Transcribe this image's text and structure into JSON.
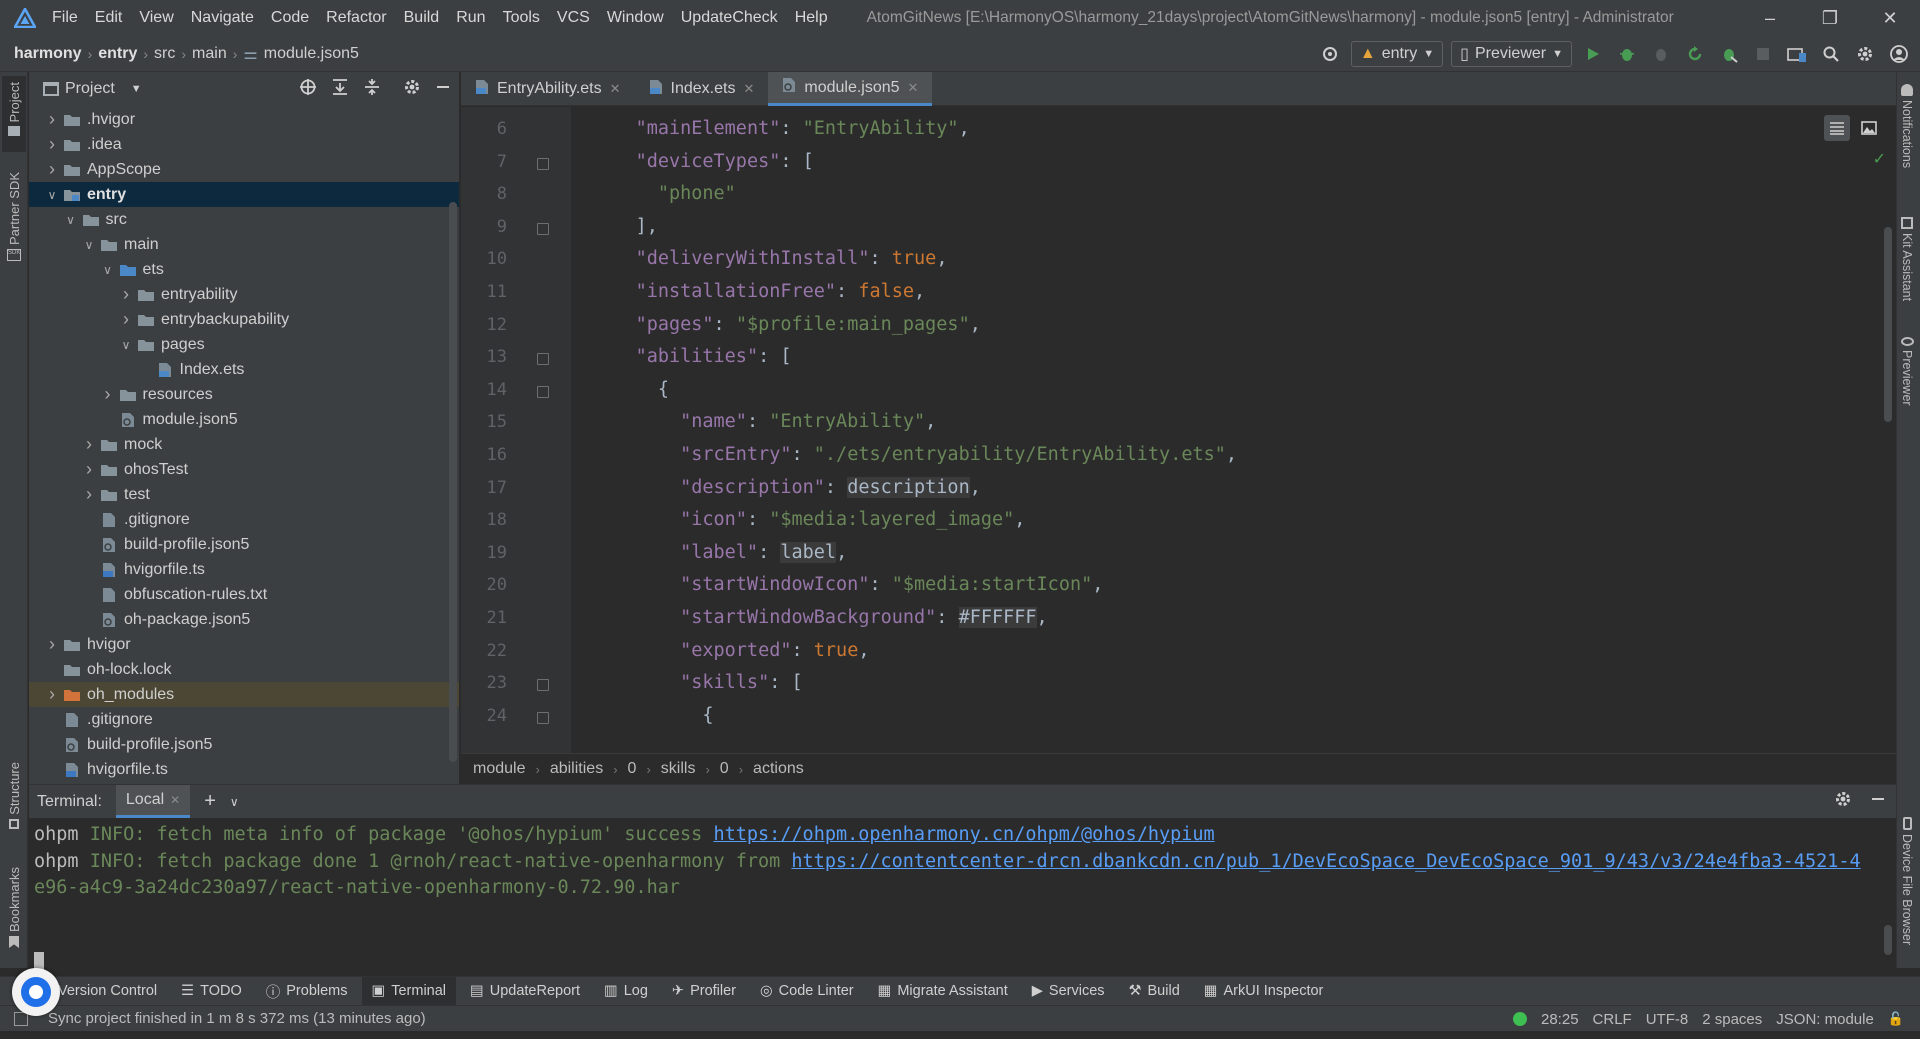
{
  "menubar": {
    "items": [
      "File",
      "Edit",
      "View",
      "Navigate",
      "Code",
      "Refactor",
      "Build",
      "Run",
      "Tools",
      "VCS",
      "Window",
      "UpdateCheck",
      "Help"
    ],
    "window_title": "AtomGitNews [E:\\HarmonyOS\\harmony_21days\\project\\AtomGitNews\\harmony] - module.json5 [entry] - Administrator"
  },
  "navbar": {
    "crumbs": [
      "harmony",
      "entry",
      "src",
      "main",
      "module.json5"
    ],
    "run_config": "entry",
    "device": "Previewer"
  },
  "left_stripe": {
    "project": "Project",
    "partner_sdk": "Partner SDK",
    "structure": "Structure",
    "bookmarks": "Bookmarks"
  },
  "right_stripe": {
    "notifications": "Notifications",
    "kit_assistant": "Kit Assistant",
    "previewer": "Previewer",
    "device_file_browser": "Device File Browser"
  },
  "project_panel": {
    "title": "Project",
    "tree": [
      {
        "label": ".hvigor",
        "type": "folder",
        "depth": 0,
        "state": "collapsed"
      },
      {
        "label": ".idea",
        "type": "folder",
        "depth": 0,
        "state": "collapsed"
      },
      {
        "label": "AppScope",
        "type": "folder",
        "depth": 0,
        "state": "collapsed"
      },
      {
        "label": "entry",
        "type": "module",
        "depth": 0,
        "state": "expanded"
      },
      {
        "label": "src",
        "type": "folder",
        "depth": 1,
        "state": "expanded"
      },
      {
        "label": "main",
        "type": "folder",
        "depth": 2,
        "state": "expanded"
      },
      {
        "label": "ets",
        "type": "source-folder",
        "depth": 3,
        "state": "expanded"
      },
      {
        "label": "entryability",
        "type": "folder",
        "depth": 4,
        "state": "collapsed"
      },
      {
        "label": "entrybackupability",
        "type": "folder",
        "depth": 4,
        "state": "collapsed"
      },
      {
        "label": "pages",
        "type": "folder",
        "depth": 4,
        "state": "expanded"
      },
      {
        "label": "Index.ets",
        "type": "ets-file",
        "depth": 5,
        "state": "none"
      },
      {
        "label": "resources",
        "type": "folder",
        "depth": 3,
        "state": "collapsed"
      },
      {
        "label": "module.json5",
        "type": "json-file",
        "depth": 3,
        "state": "none"
      },
      {
        "label": "mock",
        "type": "folder",
        "depth": 2,
        "state": "collapsed"
      },
      {
        "label": "ohosTest",
        "type": "folder",
        "depth": 2,
        "state": "collapsed"
      },
      {
        "label": "test",
        "type": "folder",
        "depth": 2,
        "state": "collapsed"
      },
      {
        "label": ".gitignore",
        "type": "file",
        "depth": 2,
        "state": "none"
      },
      {
        "label": "build-profile.json5",
        "type": "json-file",
        "depth": 2,
        "state": "none"
      },
      {
        "label": "hvigorfile.ts",
        "type": "ts-file",
        "depth": 2,
        "state": "none"
      },
      {
        "label": "obfuscation-rules.txt",
        "type": "file",
        "depth": 2,
        "state": "none"
      },
      {
        "label": "oh-package.json5",
        "type": "json-file",
        "depth": 2,
        "state": "none"
      },
      {
        "label": "hvigor",
        "type": "folder",
        "depth": 0,
        "state": "collapsed"
      },
      {
        "label": "oh-lock.lock",
        "type": "folder",
        "depth": 0,
        "state": "none"
      },
      {
        "label": "oh_modules",
        "type": "excluded-folder",
        "depth": 0,
        "state": "collapsed"
      },
      {
        "label": ".gitignore",
        "type": "file",
        "depth": 0,
        "state": "none"
      },
      {
        "label": "build-profile.json5",
        "type": "json-file",
        "depth": 0,
        "state": "none"
      },
      {
        "label": "hvigorfile.ts",
        "type": "ts-file",
        "depth": 0,
        "state": "none"
      }
    ]
  },
  "editor": {
    "tabs": [
      "EntryAbility.ets",
      "Index.ets",
      "module.json5"
    ],
    "active_tab": "module.json5",
    "lines": [
      {
        "n": "6",
        "indent": "    ",
        "parts": [
          [
            "k",
            "\"mainElement\""
          ],
          [
            "p",
            ": "
          ],
          [
            "s",
            "\"EntryAbility\""
          ],
          [
            "p",
            ","
          ]
        ]
      },
      {
        "n": "7",
        "indent": "    ",
        "parts": [
          [
            "k",
            "\"deviceTypes\""
          ],
          [
            "p",
            ": ["
          ]
        ]
      },
      {
        "n": "8",
        "indent": "      ",
        "parts": [
          [
            "s",
            "\"phone\""
          ]
        ]
      },
      {
        "n": "9",
        "indent": "    ",
        "parts": [
          [
            "p",
            "],"
          ]
        ]
      },
      {
        "n": "10",
        "indent": "    ",
        "parts": [
          [
            "k",
            "\"deliveryWithInstall\""
          ],
          [
            "p",
            ": "
          ],
          [
            "b",
            "true"
          ],
          [
            "p",
            ","
          ]
        ]
      },
      {
        "n": "11",
        "indent": "    ",
        "parts": [
          [
            "k",
            "\"installationFree\""
          ],
          [
            "p",
            ": "
          ],
          [
            "b",
            "false"
          ],
          [
            "p",
            ","
          ]
        ]
      },
      {
        "n": "12",
        "indent": "    ",
        "parts": [
          [
            "k",
            "\"pages\""
          ],
          [
            "p",
            ": "
          ],
          [
            "s",
            "\"$profile:main_pages\""
          ],
          [
            "p",
            ","
          ]
        ]
      },
      {
        "n": "13",
        "indent": "    ",
        "parts": [
          [
            "k",
            "\"abilities\""
          ],
          [
            "p",
            ": ["
          ]
        ]
      },
      {
        "n": "14",
        "indent": "      ",
        "parts": [
          [
            "p",
            "{"
          ]
        ]
      },
      {
        "n": "15",
        "indent": "        ",
        "parts": [
          [
            "k",
            "\"name\""
          ],
          [
            "p",
            ": "
          ],
          [
            "s",
            "\"EntryAbility\""
          ],
          [
            "p",
            ","
          ]
        ]
      },
      {
        "n": "16",
        "indent": "        ",
        "parts": [
          [
            "k",
            "\"srcEntry\""
          ],
          [
            "p",
            ": "
          ],
          [
            "s",
            "\"./ets/entryability/EntryAbility.ets\""
          ],
          [
            "p",
            ","
          ]
        ]
      },
      {
        "n": "17",
        "indent": "        ",
        "parts": [
          [
            "k",
            "\"description\""
          ],
          [
            "p",
            ": "
          ],
          [
            "hl",
            "description"
          ],
          [
            "p",
            ","
          ]
        ]
      },
      {
        "n": "18",
        "indent": "        ",
        "parts": [
          [
            "k",
            "\"icon\""
          ],
          [
            "p",
            ": "
          ],
          [
            "s",
            "\"$media:layered_image\""
          ],
          [
            "p",
            ","
          ]
        ]
      },
      {
        "n": "19",
        "indent": "        ",
        "parts": [
          [
            "k",
            "\"label\""
          ],
          [
            "p",
            ": "
          ],
          [
            "hl",
            "label"
          ],
          [
            "p",
            ","
          ]
        ]
      },
      {
        "n": "20",
        "indent": "        ",
        "parts": [
          [
            "k",
            "\"startWindowIcon\""
          ],
          [
            "p",
            ": "
          ],
          [
            "s",
            "\"$media:startIcon\""
          ],
          [
            "p",
            ","
          ]
        ]
      },
      {
        "n": "21",
        "indent": "        ",
        "parts": [
          [
            "k",
            "\"startWindowBackground\""
          ],
          [
            "p",
            ": "
          ],
          [
            "hl",
            "#FFFFFF"
          ],
          [
            "p",
            ","
          ]
        ]
      },
      {
        "n": "22",
        "indent": "        ",
        "parts": [
          [
            "k",
            "\"exported\""
          ],
          [
            "p",
            ": "
          ],
          [
            "b",
            "true"
          ],
          [
            "p",
            ","
          ]
        ]
      },
      {
        "n": "23",
        "indent": "        ",
        "parts": [
          [
            "k",
            "\"skills\""
          ],
          [
            "p",
            ": ["
          ]
        ]
      },
      {
        "n": "24",
        "indent": "          ",
        "parts": [
          [
            "p",
            "{"
          ]
        ]
      }
    ],
    "breadcrumb": [
      "module",
      "abilities",
      "0",
      "skills",
      "0",
      "actions"
    ]
  },
  "terminal": {
    "label": "Terminal:",
    "tab": "Local",
    "lines": [
      {
        "prefix": "ohpm ",
        "level": "INFO",
        "text": ": fetch meta info of package '@ohos/hypium' success ",
        "link": "https://ohpm.openharmony.cn/ohpm/@ohos/hypium"
      },
      {
        "prefix": "ohpm ",
        "level": "INFO",
        "text": ": fetch package done 1 @rnoh/react-native-openharmony from ",
        "link": "https://contentcenter-drcn.dbankcdn.cn/pub_1/DevEcoSpace_DevEcoSpace_901_9/43/v3/24e4fba3-4521-4"
      },
      {
        "prefix": "",
        "level": "",
        "text": "e96-a4c9-3a24dc230a97/react-native-openharmony-0.72.90.har",
        "link": ""
      }
    ]
  },
  "bottom_tabs": [
    "Version Control",
    "TODO",
    "Problems",
    "Terminal",
    "UpdateReport",
    "Log",
    "Profiler",
    "Code Linter",
    "Migrate Assistant",
    "Services",
    "Build",
    "ArkUI Inspector"
  ],
  "active_bottom_tab": "Terminal",
  "status": {
    "message": "Sync project finished in 1 m 8 s 372 ms (13 minutes ago)",
    "position": "28:25",
    "line_sep": "CRLF",
    "encoding": "UTF-8",
    "indent": "2 spaces",
    "schema": "JSON: module"
  },
  "colors": {
    "accent": "#4a88c7",
    "key": "#9876aa",
    "string": "#6a8759",
    "keyword": "#cc7832",
    "link": "#589df6",
    "folder": "#87939a",
    "excluded_folder": "#d2733b",
    "status_ok": "#3ebf52"
  }
}
